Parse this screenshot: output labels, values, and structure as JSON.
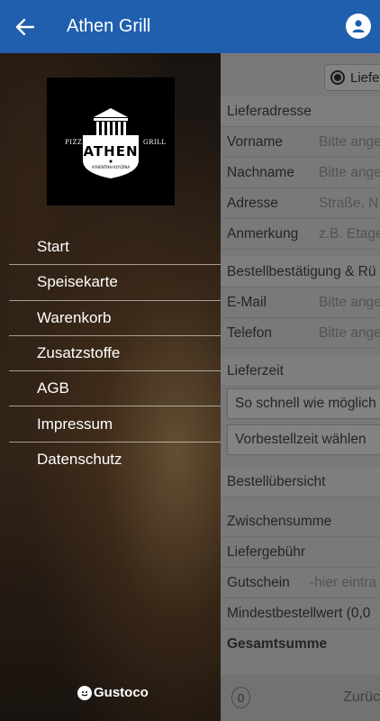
{
  "appbar": {
    "title": "Athen Grill"
  },
  "drawer": {
    "logo": {
      "wordmark": "ATHEN",
      "left_text": "PIZZERIA",
      "right_text": "GRILL",
      "tagline": "ΑΥΘΕΝΤΙΚΗ ΚΟΥΖΙΝΑ"
    },
    "menu": [
      {
        "label": "Start"
      },
      {
        "label": "Speisekarte"
      },
      {
        "label": "Warenkorb"
      },
      {
        "label": "Zusatzstoffe"
      },
      {
        "label": "AGB"
      },
      {
        "label": "Impressum"
      },
      {
        "label": "Datenschutz"
      }
    ],
    "brand": "Gustoco"
  },
  "form": {
    "delivery_option": "Liefe",
    "address_header": "Lieferadresse",
    "firstname": {
      "label": "Vorname",
      "placeholder": "Bitte ange"
    },
    "lastname": {
      "label": "Nachname",
      "placeholder": "Bitte ange"
    },
    "address": {
      "label": "Adresse",
      "placeholder": "Straße, N"
    },
    "note": {
      "label": "Anmerkung",
      "placeholder": "z.B. Etage"
    },
    "confirm_header": "Bestellbestätigung & Rü",
    "email": {
      "label": "E-Mail",
      "placeholder": "Bitte ange"
    },
    "phone": {
      "label": "Telefon",
      "placeholder": "Bitte ange"
    },
    "time_header": "Lieferzeit",
    "asap": "So schnell wie möglich",
    "preorder": "Vorbestellzeit wählen",
    "summary_header": "Bestellübersicht",
    "subtotal": "Zwischensumme",
    "delivery_fee": "Liefergebühr",
    "voucher": {
      "label": "Gutschein",
      "placeholder": "-hier eintra"
    },
    "minimum": "Mindestbestellwert (0,0",
    "total": "Gesamtsumme",
    "cart_count": "0",
    "back_label": "Zurüc"
  },
  "colors": {
    "appbar": "#1f5fae"
  }
}
